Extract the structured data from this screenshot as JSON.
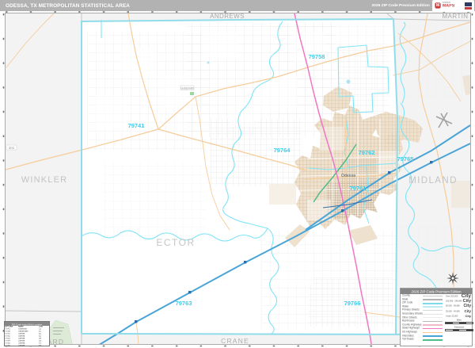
{
  "header": {
    "title": "ODESSA, TX METROPOLITAN STATISTICAL AREA",
    "edition": "2026 ZIP Code Premium Edition",
    "logo": {
      "mark": "M",
      "market": "Market",
      "maps": "MAPS"
    }
  },
  "counties": [
    {
      "name": "ANDREWS"
    },
    {
      "name": "MARTIN"
    },
    {
      "name": "WINKLER"
    },
    {
      "name": "MIDLAND"
    },
    {
      "name": "ECTOR"
    },
    {
      "name": "CRANE"
    },
    {
      "name": "WARD"
    }
  ],
  "zip_labels": [
    {
      "code": "79758"
    },
    {
      "code": "79741"
    },
    {
      "code": "79764"
    },
    {
      "code": "79762"
    },
    {
      "code": "79765"
    },
    {
      "code": "79761"
    },
    {
      "code": "79763"
    },
    {
      "code": "79766"
    }
  ],
  "places": [
    {
      "name": "Odessa"
    },
    {
      "name": "Goldsmith"
    }
  ],
  "road_labels": [
    {
      "number": "302"
    }
  ],
  "legend": {
    "header": "2026 ZIP Code Premium Edition",
    "rows": [
      {
        "label": "County",
        "color": "#c9c9c9",
        "h": 1.6
      },
      {
        "label": "State",
        "color": "#b4b4b4",
        "h": 1.6
      },
      {
        "label": "ZIP Code",
        "color": "#7fd9ea",
        "h": 1.8
      },
      {
        "label": "Water",
        "color": "#bfe9f5",
        "h": 1.8
      },
      {
        "label": "Primary Streets",
        "color": "#d8d8d8",
        "h": 1.2
      },
      {
        "label": "Secondary Streets",
        "color": "#e2e2e2",
        "h": 1.2
      },
      {
        "label": "Other Streets",
        "color": "#ececec",
        "h": 1
      },
      {
        "label": "Rail Roads",
        "color": "#b9b9b9",
        "h": 1
      },
      {
        "label": "County Highways",
        "color": "#f0b8cd",
        "h": 1.4
      },
      {
        "label": "State Highways",
        "color": "#f176c4",
        "h": 1.4
      },
      {
        "label": "US Highways",
        "color": "#f6cc9a",
        "h": 1.8
      },
      {
        "label": "Interstates",
        "color": "#4aa5d6",
        "h": 2.2
      },
      {
        "label": "Toll Roads",
        "color": "#52bb8a",
        "h": 1.8
      }
    ],
    "cities": [
      {
        "pop": "Over 250,000",
        "sample": "City",
        "size": 6.5
      },
      {
        "pop": "100,000 - 249,999",
        "sample": "City",
        "size": 5.5
      },
      {
        "pop": "50,000 - 99,999",
        "sample": "City",
        "size": 5
      },
      {
        "pop": "25,000 - 49,999",
        "sample": "City",
        "size": 4.5
      },
      {
        "pop": "Under 25,000",
        "sample": "City",
        "size": 4
      }
    ],
    "scalebars": [
      {
        "label": "Miles"
      },
      {
        "label": "Kilometers"
      }
    ]
  },
  "zip_index": {
    "header": "ZIP Code Index/Grid Location",
    "columns": [
      "ZIP Code",
      "Name",
      "Grid"
    ],
    "rows": [
      {
        "zip": "79741",
        "name": "Goldsmith",
        "grid": "C2"
      },
      {
        "zip": "79758",
        "name": "Gardendale",
        "grid": "E1"
      },
      {
        "zip": "79761",
        "name": "Odessa",
        "grid": "E3"
      },
      {
        "zip": "79762",
        "name": "Odessa",
        "grid": "E2"
      },
      {
        "zip": "79763",
        "name": "Odessa",
        "grid": "D4"
      },
      {
        "zip": "79764",
        "name": "Odessa",
        "grid": "D2"
      },
      {
        "zip": "79765",
        "name": "Odessa",
        "grid": "F3"
      },
      {
        "zip": "79766",
        "name": "Odessa",
        "grid": "E4"
      }
    ]
  }
}
